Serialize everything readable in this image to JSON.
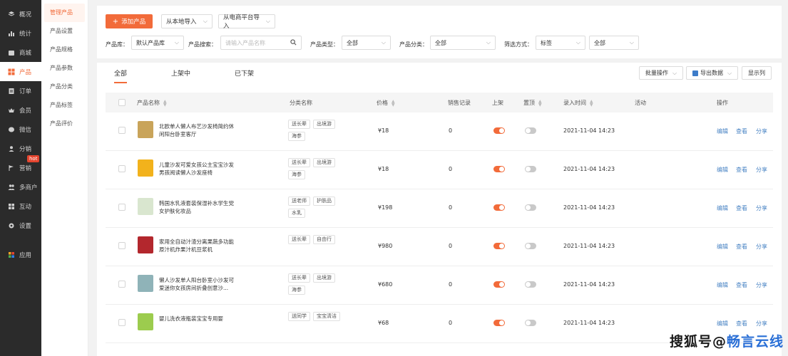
{
  "sidebar": {
    "items": [
      {
        "label": "概况",
        "icon": "layers-icon",
        "name": "sidebar-item-overview"
      },
      {
        "label": "统计",
        "icon": "chart-icon",
        "name": "sidebar-item-stats"
      },
      {
        "label": "商城",
        "icon": "shop-icon",
        "name": "sidebar-item-mall"
      },
      {
        "label": "产品",
        "icon": "grid-icon",
        "name": "sidebar-item-products",
        "active": true
      },
      {
        "label": "订单",
        "icon": "order-icon",
        "name": "sidebar-item-orders"
      },
      {
        "label": "会员",
        "icon": "crown-icon",
        "name": "sidebar-item-members"
      },
      {
        "label": "微信",
        "icon": "wechat-icon",
        "name": "sidebar-item-wechat"
      },
      {
        "label": "分销",
        "icon": "user-icon",
        "name": "sidebar-item-distribution"
      },
      {
        "label": "营销",
        "icon": "flag-icon",
        "name": "sidebar-item-marketing",
        "badge": "hot"
      },
      {
        "label": "多商户",
        "icon": "users-icon",
        "name": "sidebar-item-merchants"
      },
      {
        "label": "互动",
        "icon": "apps-icon",
        "name": "sidebar-item-interaction"
      },
      {
        "label": "设置",
        "icon": "gear-icon",
        "name": "sidebar-item-settings"
      }
    ],
    "apps_label": "应用"
  },
  "subnav": {
    "items": [
      "管理产品",
      "产品设置",
      "产品规格",
      "产品参数",
      "产品分类",
      "产品标签",
      "产品评价"
    ]
  },
  "toolbar": {
    "add_product": "添加产品",
    "import_local": "从本地导入",
    "import_ecommerce": "从电商平台导入"
  },
  "filters": {
    "library_label": "产品库：",
    "library_value": "默认产品库",
    "search_label": "产品搜索：",
    "search_placeholder": "请输入产品名称",
    "type_label": "产品类型：",
    "type_value": "全部",
    "category_label": "产品分类：",
    "category_value": "全部",
    "filter_label": "筛选方式：",
    "filter_value": "标签",
    "filter_value2": "全部"
  },
  "tabs": [
    "全部",
    "上架中",
    "已下架"
  ],
  "actions": {
    "batch": "批量操作",
    "export": "导出数据",
    "columns": "显示列"
  },
  "table": {
    "headers": {
      "name": "产品名称",
      "category": "分类名称",
      "price": "价格",
      "sales": "销售记录",
      "listed": "上架",
      "top": "置顶",
      "time": "录入时间",
      "activity": "活动",
      "ops": "操作"
    },
    "row_actions": {
      "edit": "编辑",
      "view": "查看",
      "share": "分享"
    },
    "rows": [
      {
        "name": "北欧单人懒人布艺沙发椅简约休闲阳台卧室客厅",
        "tags": [
          "送长辈",
          "出境游",
          "海参"
        ],
        "price": "¥18",
        "sales": "0",
        "listed": true,
        "top": false,
        "time": "2021-11-04 14:23",
        "thumb": "#c9a45a"
      },
      {
        "name": "儿童沙发可爱女孩公主宝宝沙发男孩阅读懒人沙发座椅",
        "tags": [
          "送长辈",
          "出境游",
          "海参"
        ],
        "price": "¥18",
        "sales": "0",
        "listed": true,
        "top": false,
        "time": "2021-11-04 14:23",
        "thumb": "#f2b21c"
      },
      {
        "name": "韩国水乳液套装保湿补水学生党女护肤化妆品",
        "tags": [
          "送老师",
          "护肤品",
          "水乳"
        ],
        "price": "¥198",
        "sales": "0",
        "listed": true,
        "top": false,
        "time": "2021-11-04 14:23",
        "thumb": "#d9e6cf"
      },
      {
        "name": "家用全自动汁渣分离果蔬多功能原汁机炸果汁机豆浆机",
        "tags": [
          "送长辈",
          "自由行"
        ],
        "price": "¥980",
        "sales": "0",
        "listed": true,
        "top": false,
        "time": "2021-11-04 14:23",
        "thumb": "#b3272d"
      },
      {
        "name": "懒人沙发单人阳台卧室小沙发可爱迷你女孩房间折叠创意沙...",
        "tags": [
          "送长辈",
          "出境游",
          "海参"
        ],
        "price": "¥680",
        "sales": "0",
        "listed": true,
        "top": false,
        "time": "2021-11-04 14:23",
        "thumb": "#8fb3b8"
      },
      {
        "name": "婴儿洗衣液瓶装宝宝专用婴",
        "tags": [
          "送同学",
          "宝宝清洁"
        ],
        "price": "¥68",
        "sales": "0",
        "listed": true,
        "top": false,
        "time": "2021-11-04 14:23",
        "thumb": "#9ccc4e"
      }
    ]
  },
  "watermark": {
    "part1": "搜狐号",
    "part2": "@",
    "part3": "畅言云线"
  }
}
